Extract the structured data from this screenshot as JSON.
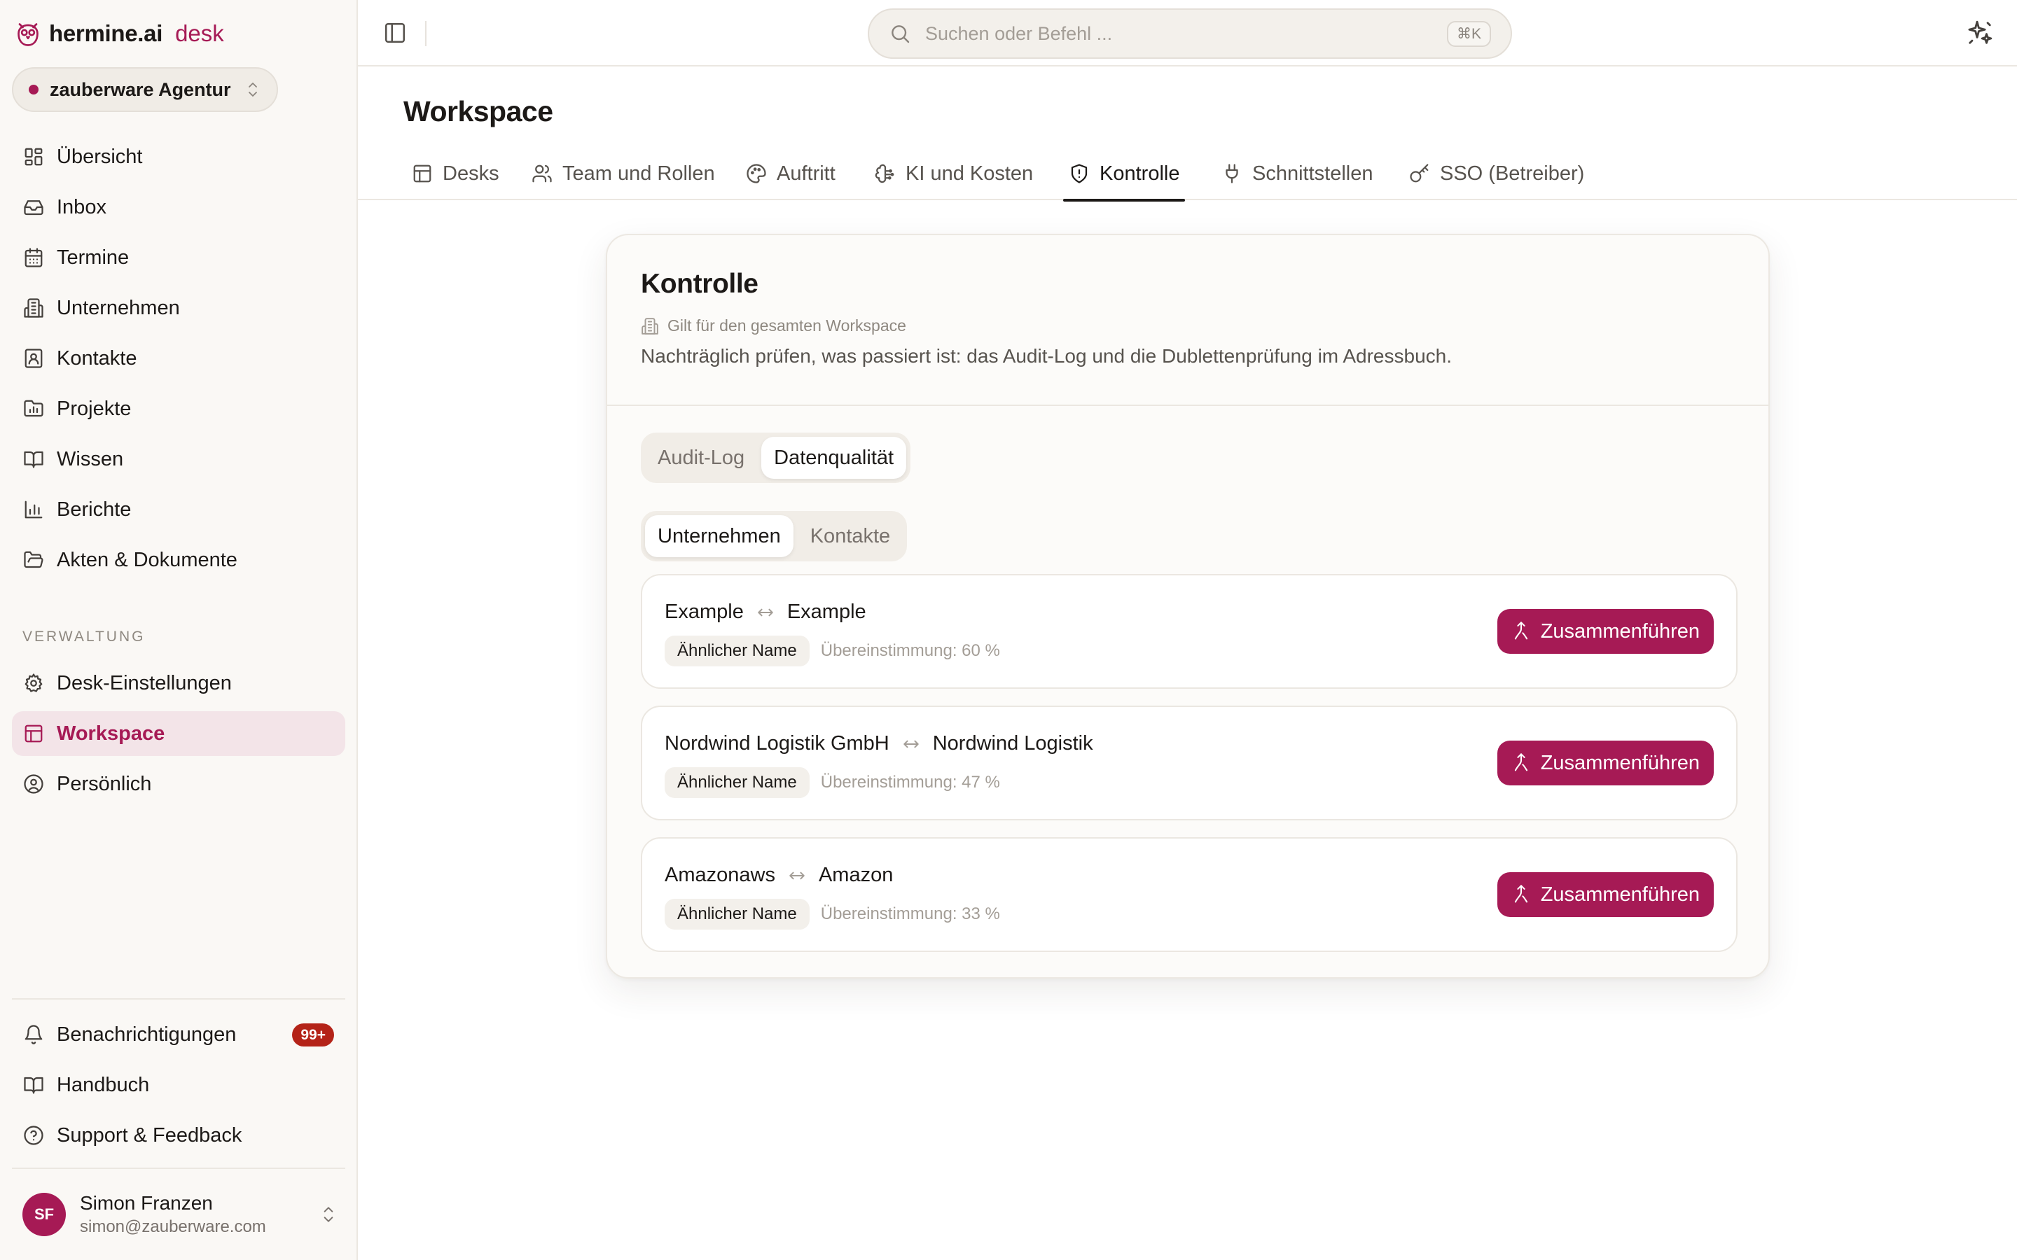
{
  "app": {
    "brand": "hermine.ai",
    "product": "desk",
    "brand_color": "#a61a55"
  },
  "workspace_switcher": {
    "name": "zauberware Agentur"
  },
  "sidebar": {
    "items": [
      {
        "label": "Übersicht",
        "icon": "dashboard-icon"
      },
      {
        "label": "Inbox",
        "icon": "inbox-icon"
      },
      {
        "label": "Termine",
        "icon": "calendar-icon"
      },
      {
        "label": "Unternehmen",
        "icon": "building-icon"
      },
      {
        "label": "Kontakte",
        "icon": "contact-card-icon"
      },
      {
        "label": "Projekte",
        "icon": "folder-chart-icon"
      },
      {
        "label": "Wissen",
        "icon": "book-open-icon"
      },
      {
        "label": "Berichte",
        "icon": "bar-chart-icon"
      },
      {
        "label": "Akten & Dokumente",
        "icon": "folder-open-icon"
      }
    ],
    "section_label": "VERWALTUNG",
    "admin_items": [
      {
        "label": "Desk-Einstellungen",
        "icon": "gear-icon"
      },
      {
        "label": "Workspace",
        "icon": "layout-icon",
        "active": true
      },
      {
        "label": "Persönlich",
        "icon": "user-circle-icon"
      }
    ],
    "bottom_items": [
      {
        "label": "Benachrichtigungen",
        "icon": "bell-icon",
        "badge": "99+"
      },
      {
        "label": "Handbuch",
        "icon": "book-open-icon"
      },
      {
        "label": "Support & Feedback",
        "icon": "help-circle-icon"
      }
    ],
    "user": {
      "initials": "SF",
      "name": "Simon Franzen",
      "email": "simon@zauberware.com"
    }
  },
  "topbar": {
    "search_placeholder": "Suchen oder Befehl ...",
    "search_shortcut": "⌘K"
  },
  "page": {
    "title": "Workspace",
    "tabs": [
      {
        "label": "Desks",
        "icon": "layout-icon"
      },
      {
        "label": "Team und Rollen",
        "icon": "users-icon"
      },
      {
        "label": "Auftritt",
        "icon": "palette-icon"
      },
      {
        "label": "KI und Kosten",
        "icon": "ai-brain-icon"
      },
      {
        "label": "Kontrolle",
        "icon": "shield-icon",
        "active": true
      },
      {
        "label": "Schnittstellen",
        "icon": "plug-icon"
      },
      {
        "label": "SSO (Betreiber)",
        "icon": "key-icon"
      }
    ]
  },
  "card": {
    "title": "Kontrolle",
    "scope": "Gilt für den gesamten Workspace",
    "description": "Nachträglich prüfen, was passiert ist: das Audit-Log und die Dublettenprüfung im Adressbuch.",
    "main_segments": [
      {
        "label": "Audit-Log",
        "active": false
      },
      {
        "label": "Datenqualität",
        "active": true
      }
    ],
    "sub_segments": [
      {
        "label": "Unternehmen",
        "active": true
      },
      {
        "label": "Kontakte",
        "active": false
      }
    ],
    "duplicates": [
      {
        "left": "Example",
        "right": "Example",
        "reason": "Ähnlicher Name",
        "match": "Übereinstimmung: 60 %",
        "action": "Zusammenführen"
      },
      {
        "left": "Nordwind Logistik GmbH",
        "right": "Nordwind Logistik",
        "reason": "Ähnlicher Name",
        "match": "Übereinstimmung: 47 %",
        "action": "Zusammenführen"
      },
      {
        "left": "Amazonaws",
        "right": "Amazon",
        "reason": "Ähnlicher Name",
        "match": "Übereinstimmung: 33 %",
        "action": "Zusammenführen"
      }
    ]
  }
}
